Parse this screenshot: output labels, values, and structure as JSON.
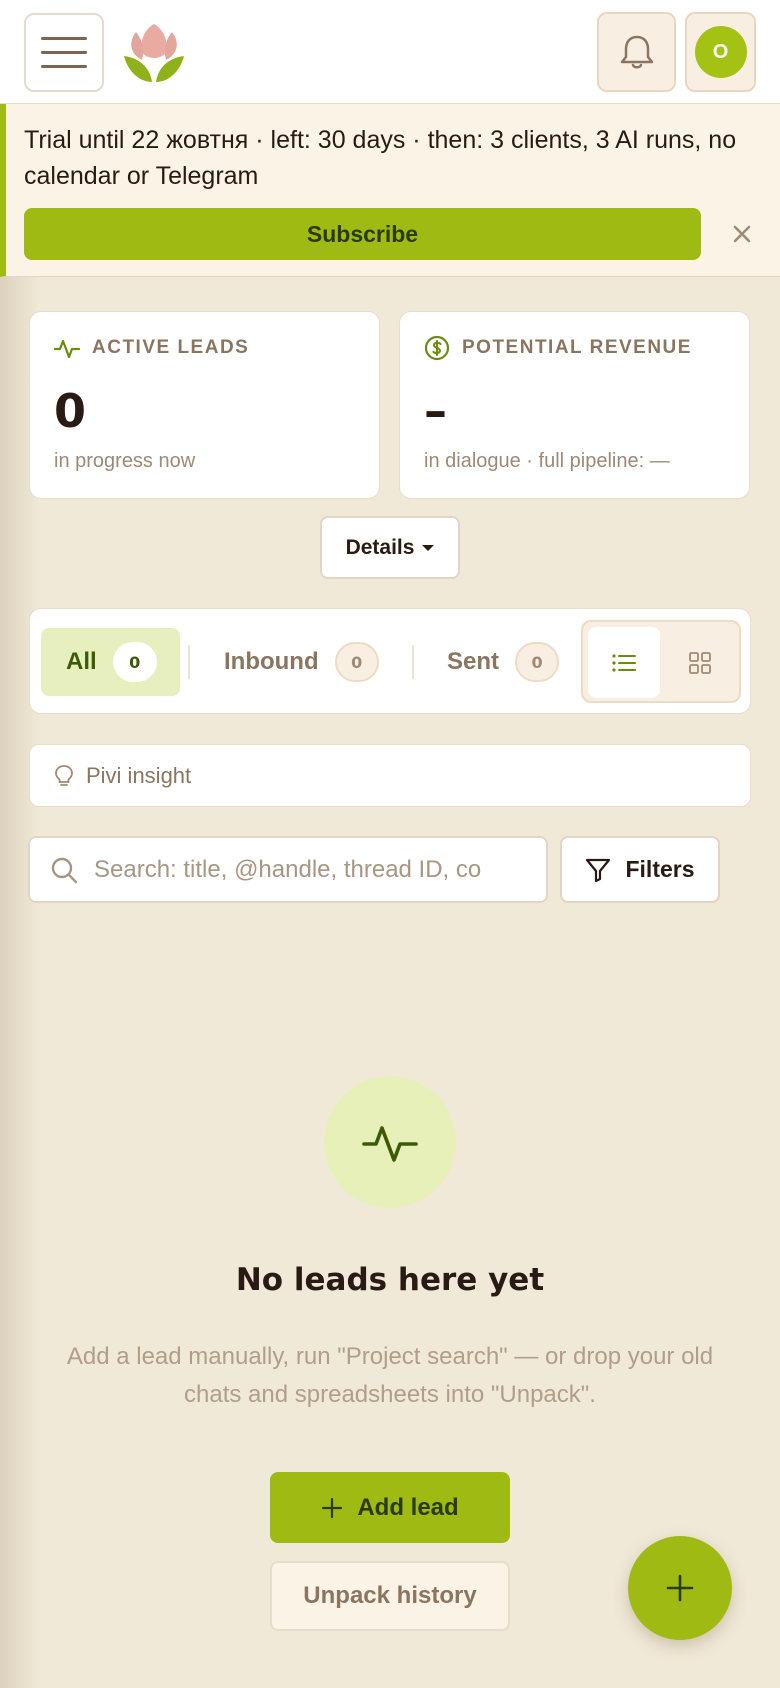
{
  "header": {
    "menu_icon": "hamburger-icon",
    "logo_icon": "lotus-logo-icon",
    "notification_icon": "bell-icon",
    "avatar_initial": "O"
  },
  "banner": {
    "text": "Trial until 22 жовтня · left: 30 days · then: 3 clients, 3 AI runs, no calendar or Telegram",
    "subscribe_label": "Subscribe",
    "close_icon": "close-icon"
  },
  "stats": {
    "active_leads": {
      "label": "ACTIVE LEADS",
      "value": "0",
      "sub": "in progress now",
      "icon": "activity-icon"
    },
    "potential_revenue": {
      "label": "POTENTIAL REVENUE",
      "value": "–",
      "sub": "in dialogue · full pipeline: —",
      "icon": "dollar-circle-icon"
    }
  },
  "details_label": "Details",
  "tabs": [
    {
      "label": "All",
      "count": "0",
      "active": true
    },
    {
      "label": "Inbound",
      "count": "0",
      "active": false
    },
    {
      "label": "Sent",
      "count": "0",
      "active": false
    }
  ],
  "view_modes": [
    "list",
    "grid"
  ],
  "insight_label": "Pivi insight",
  "search": {
    "placeholder": "Search: title, @handle, thread ID, co",
    "value": ""
  },
  "filters_label": "Filters",
  "empty_state": {
    "title": "No leads here yet",
    "description": "Add a lead manually, run \"Project search\" — or drop your old chats and spreadsheets into \"Unpack\".",
    "add_lead_label": "Add lead",
    "unpack_label": "Unpack history"
  },
  "colors": {
    "accent": "#9fba13",
    "background": "#f1e9d8",
    "text_muted": "#8a7561"
  }
}
